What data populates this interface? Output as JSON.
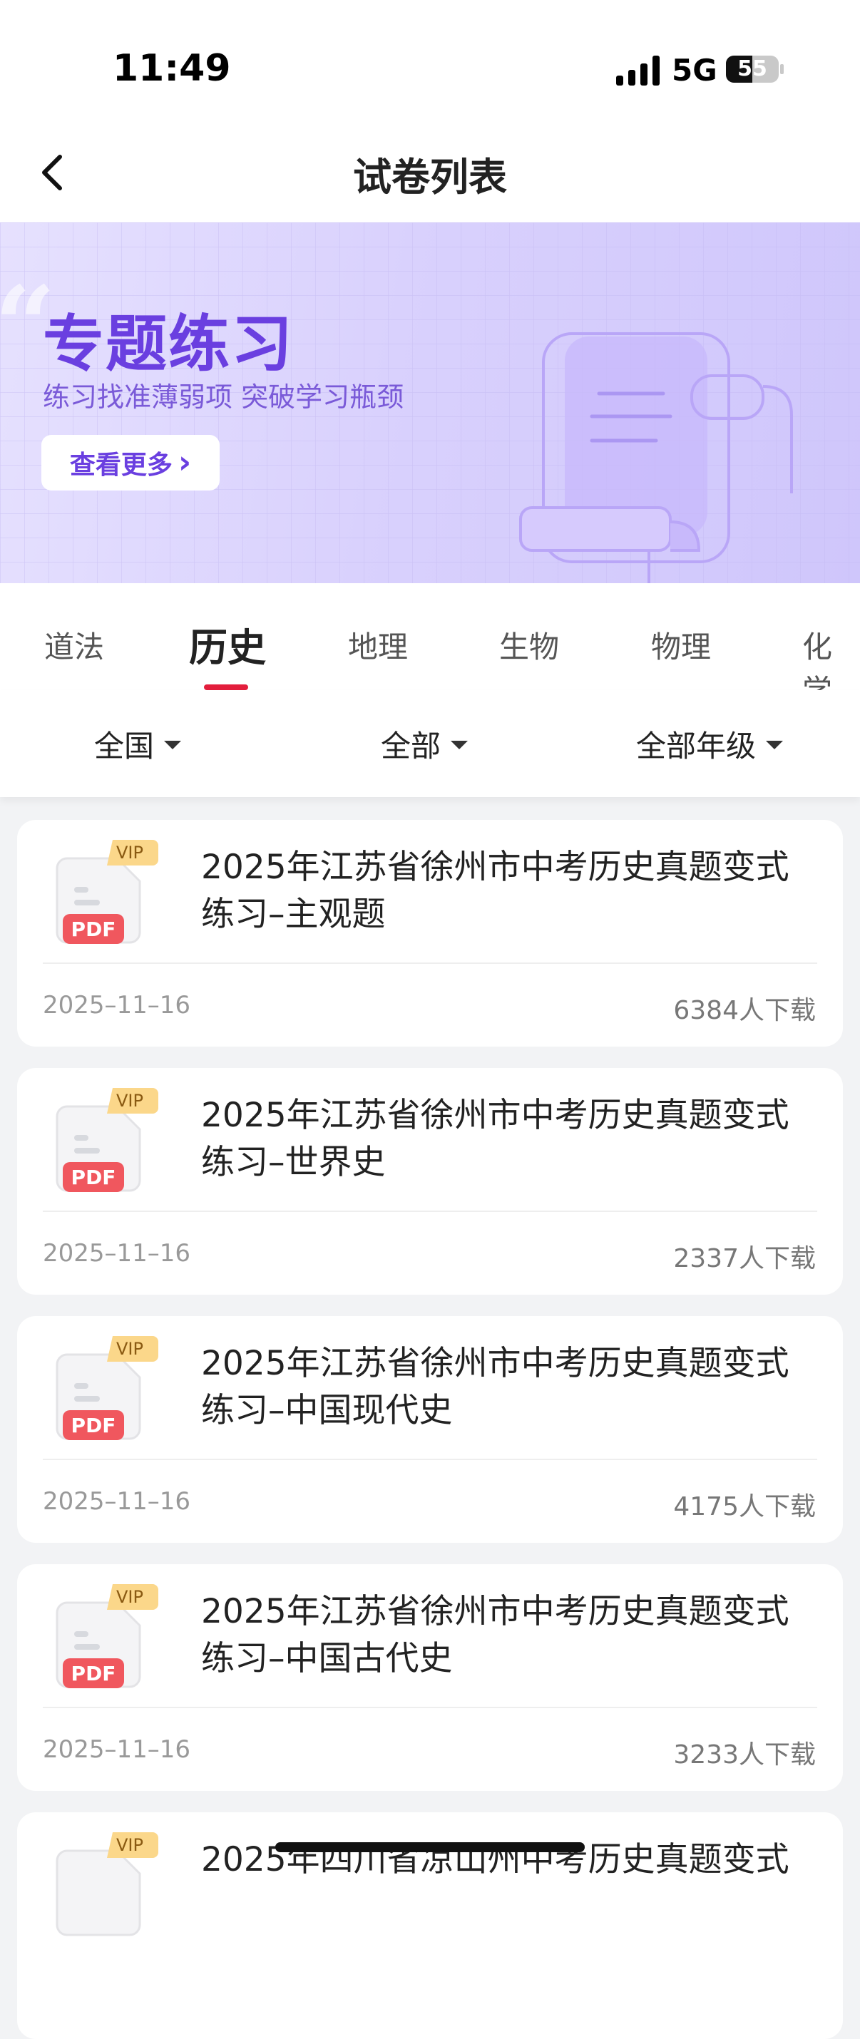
{
  "status_bar": {
    "time": "11:49",
    "network": "5G",
    "battery": "55"
  },
  "nav": {
    "title": "试卷列表"
  },
  "banner": {
    "quote_mark": "“",
    "title": "专题练习",
    "subtitle": "练习找准薄弱项 突破学习瓶颈",
    "button_label": "查看更多",
    "button_arrow": "›"
  },
  "tabs": [
    {
      "label": "道法"
    },
    {
      "label": "历史"
    },
    {
      "label": "地理"
    },
    {
      "label": "生物"
    },
    {
      "label": "物理"
    },
    {
      "label": "化学"
    }
  ],
  "active_tab": "历史",
  "filters": {
    "region": "全国",
    "type": "全部",
    "grade": "全部年级"
  },
  "icon_labels": {
    "vip": "VIP",
    "pdf": "PDF"
  },
  "papers": [
    {
      "title": "2025年江苏省徐州市中考历史真题变式练习–主观题",
      "date": "2025–11–16",
      "downloads": "6384人下载"
    },
    {
      "title": "2025年江苏省徐州市中考历史真题变式练习–世界史",
      "date": "2025–11–16",
      "downloads": "2337人下载"
    },
    {
      "title": "2025年江苏省徐州市中考历史真题变式练习–中国现代史",
      "date": "2025–11–16",
      "downloads": "4175人下载"
    },
    {
      "title": "2025年江苏省徐州市中考历史真题变式练习–中国古代史",
      "date": "2025–11–16",
      "downloads": "3233人下载"
    },
    {
      "title": "2025年四川省凉山州中考历史真题变式",
      "date": "",
      "downloads": ""
    }
  ],
  "colors": {
    "accent": "#e31e3c",
    "banner_purple": "#6a3fe0",
    "pdf_red": "#f0575e",
    "vip_gold": "#fbd78a"
  }
}
